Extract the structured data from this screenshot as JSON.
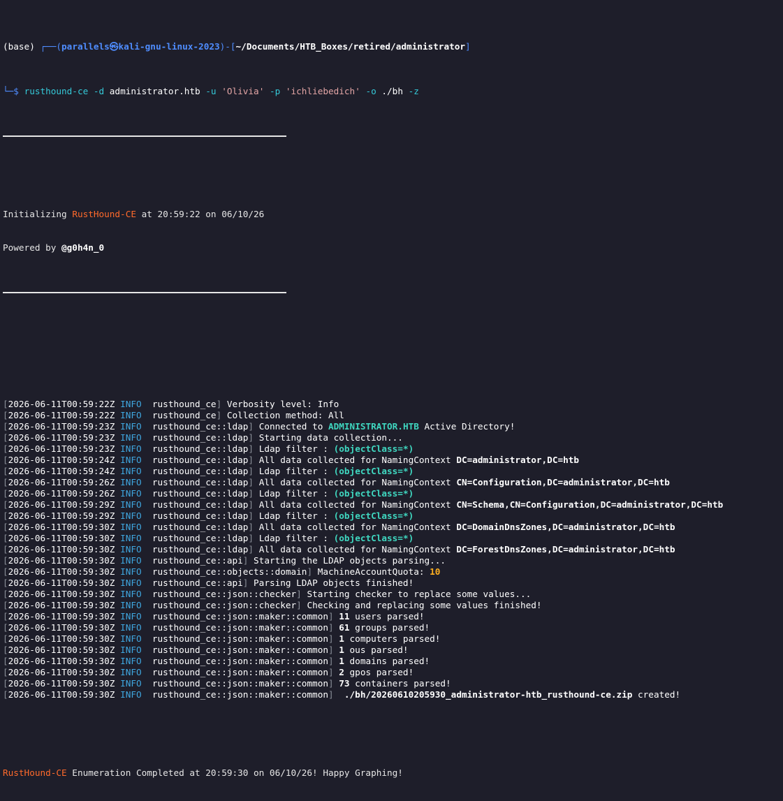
{
  "prompt": {
    "base": "(base)",
    "corner": " ┌──(",
    "user_host": "parallels㉿kali-gnu-linux-2023",
    "mid": ")-[",
    "path": "~/Documents/HTB_Boxes/retired/administrator",
    "end": "]",
    "arrow": "└─$",
    "command": "rusthound-ce",
    "arg1": " -d ",
    "arg1_val": "administrator.htb",
    "arg2": " -u ",
    "arg2_val": "'Olivia'",
    "arg3": " -p ",
    "arg3_val": "'ichliebedich'",
    "arg4": " -o ",
    "arg4_val": "./bh",
    "arg5": " -z"
  },
  "banner": {
    "init_prefix": "Initializing ",
    "tool": "RustHound-CE",
    "init_suffix": " at 20:59:22 on 06/10/26",
    "powered_prefix": "Powered by ",
    "author": "@g0h4n_0"
  },
  "log": [
    {
      "ts": "2026-06-11T00:59:22Z",
      "level": "INFO",
      "module": "rusthound_ce",
      "msg": "Verbosity level: Info",
      "hl": "",
      "tail": "",
      "hl_style": ""
    },
    {
      "ts": "2026-06-11T00:59:22Z",
      "level": "INFO",
      "module": "rusthound_ce",
      "msg": "Collection method: All",
      "hl": "",
      "tail": "",
      "hl_style": ""
    },
    {
      "ts": "2026-06-11T00:59:23Z",
      "level": "INFO",
      "module": "rusthound_ce::ldap",
      "msg": "Connected to ",
      "hl": "ADMINISTRATOR.HTB",
      "tail": " Active Directory!",
      "hl_style": "teal"
    },
    {
      "ts": "2026-06-11T00:59:23Z",
      "level": "INFO",
      "module": "rusthound_ce::ldap",
      "msg": "Starting data collection...",
      "hl": "",
      "tail": "",
      "hl_style": ""
    },
    {
      "ts": "2026-06-11T00:59:23Z",
      "level": "INFO",
      "module": "rusthound_ce::ldap",
      "msg": "Ldap filter : ",
      "hl": "(objectClass=*)",
      "tail": "",
      "hl_style": "teal"
    },
    {
      "ts": "2026-06-11T00:59:24Z",
      "level": "INFO",
      "module": "rusthound_ce::ldap",
      "msg": "All data collected for NamingContext ",
      "hl": "DC=administrator,DC=htb",
      "tail": "",
      "hl_style": "white"
    },
    {
      "ts": "2026-06-11T00:59:24Z",
      "level": "INFO",
      "module": "rusthound_ce::ldap",
      "msg": "Ldap filter : ",
      "hl": "(objectClass=*)",
      "tail": "",
      "hl_style": "teal"
    },
    {
      "ts": "2026-06-11T00:59:26Z",
      "level": "INFO",
      "module": "rusthound_ce::ldap",
      "msg": "All data collected for NamingContext ",
      "hl": "CN=Configuration,DC=administrator,DC=htb",
      "tail": "",
      "hl_style": "white"
    },
    {
      "ts": "2026-06-11T00:59:26Z",
      "level": "INFO",
      "module": "rusthound_ce::ldap",
      "msg": "Ldap filter : ",
      "hl": "(objectClass=*)",
      "tail": "",
      "hl_style": "teal"
    },
    {
      "ts": "2026-06-11T00:59:29Z",
      "level": "INFO",
      "module": "rusthound_ce::ldap",
      "msg": "All data collected for NamingContext ",
      "hl": "CN=Schema,CN=Configuration,DC=administrator,DC=htb",
      "tail": "",
      "hl_style": "white"
    },
    {
      "ts": "2026-06-11T00:59:29Z",
      "level": "INFO",
      "module": "rusthound_ce::ldap",
      "msg": "Ldap filter : ",
      "hl": "(objectClass=*)",
      "tail": "",
      "hl_style": "teal"
    },
    {
      "ts": "2026-06-11T00:59:30Z",
      "level": "INFO",
      "module": "rusthound_ce::ldap",
      "msg": "All data collected for NamingContext ",
      "hl": "DC=DomainDnsZones,DC=administrator,DC=htb",
      "tail": "",
      "hl_style": "white"
    },
    {
      "ts": "2026-06-11T00:59:30Z",
      "level": "INFO",
      "module": "rusthound_ce::ldap",
      "msg": "Ldap filter : ",
      "hl": "(objectClass=*)",
      "tail": "",
      "hl_style": "teal"
    },
    {
      "ts": "2026-06-11T00:59:30Z",
      "level": "INFO",
      "module": "rusthound_ce::ldap",
      "msg": "All data collected for NamingContext ",
      "hl": "DC=ForestDnsZones,DC=administrator,DC=htb",
      "tail": "",
      "hl_style": "white"
    },
    {
      "ts": "2026-06-11T00:59:30Z",
      "level": "INFO",
      "module": "rusthound_ce::api",
      "msg": "Starting the LDAP objects parsing...",
      "hl": "",
      "tail": "",
      "hl_style": ""
    },
    {
      "ts": "2026-06-11T00:59:30Z",
      "level": "INFO",
      "module": "rusthound_ce::objects::domain",
      "msg": "MachineAccountQuota: ",
      "hl": "10",
      "tail": "",
      "hl_style": "yellow"
    },
    {
      "ts": "2026-06-11T00:59:30Z",
      "level": "INFO",
      "module": "rusthound_ce::api",
      "msg": "Parsing LDAP objects finished!",
      "hl": "",
      "tail": "",
      "hl_style": ""
    },
    {
      "ts": "2026-06-11T00:59:30Z",
      "level": "INFO",
      "module": "rusthound_ce::json::checker",
      "msg": "Starting checker to replace some values...",
      "hl": "",
      "tail": "",
      "hl_style": ""
    },
    {
      "ts": "2026-06-11T00:59:30Z",
      "level": "INFO",
      "module": "rusthound_ce::json::checker",
      "msg": "Checking and replacing some values finished!",
      "hl": "",
      "tail": "",
      "hl_style": ""
    },
    {
      "ts": "2026-06-11T00:59:30Z",
      "level": "INFO",
      "module": "rusthound_ce::json::maker::common",
      "msg": "",
      "hl": "11",
      "tail": " users parsed!",
      "hl_style": "white"
    },
    {
      "ts": "2026-06-11T00:59:30Z",
      "level": "INFO",
      "module": "rusthound_ce::json::maker::common",
      "msg": "",
      "hl": "61",
      "tail": " groups parsed!",
      "hl_style": "white"
    },
    {
      "ts": "2026-06-11T00:59:30Z",
      "level": "INFO",
      "module": "rusthound_ce::json::maker::common",
      "msg": "",
      "hl": "1",
      "tail": " computers parsed!",
      "hl_style": "white"
    },
    {
      "ts": "2026-06-11T00:59:30Z",
      "level": "INFO",
      "module": "rusthound_ce::json::maker::common",
      "msg": "",
      "hl": "1",
      "tail": " ous parsed!",
      "hl_style": "white"
    },
    {
      "ts": "2026-06-11T00:59:30Z",
      "level": "INFO",
      "module": "rusthound_ce::json::maker::common",
      "msg": "",
      "hl": "1",
      "tail": " domains parsed!",
      "hl_style": "white"
    },
    {
      "ts": "2026-06-11T00:59:30Z",
      "level": "INFO",
      "module": "rusthound_ce::json::maker::common",
      "msg": "",
      "hl": "2",
      "tail": " gpos parsed!",
      "hl_style": "white"
    },
    {
      "ts": "2026-06-11T00:59:30Z",
      "level": "INFO",
      "module": "rusthound_ce::json::maker::common",
      "msg": "",
      "hl": "73",
      "tail": " containers parsed!",
      "hl_style": "white"
    },
    {
      "ts": "2026-06-11T00:59:30Z",
      "level": "INFO",
      "module": "rusthound_ce::json::maker::common",
      "msg": " ",
      "hl": "./bh/20260610205930_administrator-htb_rusthound-ce.zip",
      "tail": " created!",
      "hl_style": "white"
    }
  ],
  "footer": {
    "tool": "RustHound-CE",
    "text": " Enumeration Completed at 20:59:30 on 06/10/26! Happy Graphing!"
  },
  "colors": {
    "background": "#1e1e2a",
    "prompt_blue": "#4f8dff",
    "command_cyan": "#35c9d8",
    "highlight_teal": "#3fd7c0",
    "brand_orange": "#ff6a2b",
    "number_yellow": "#ffb020",
    "bracket_grey": "#8a8f98"
  }
}
